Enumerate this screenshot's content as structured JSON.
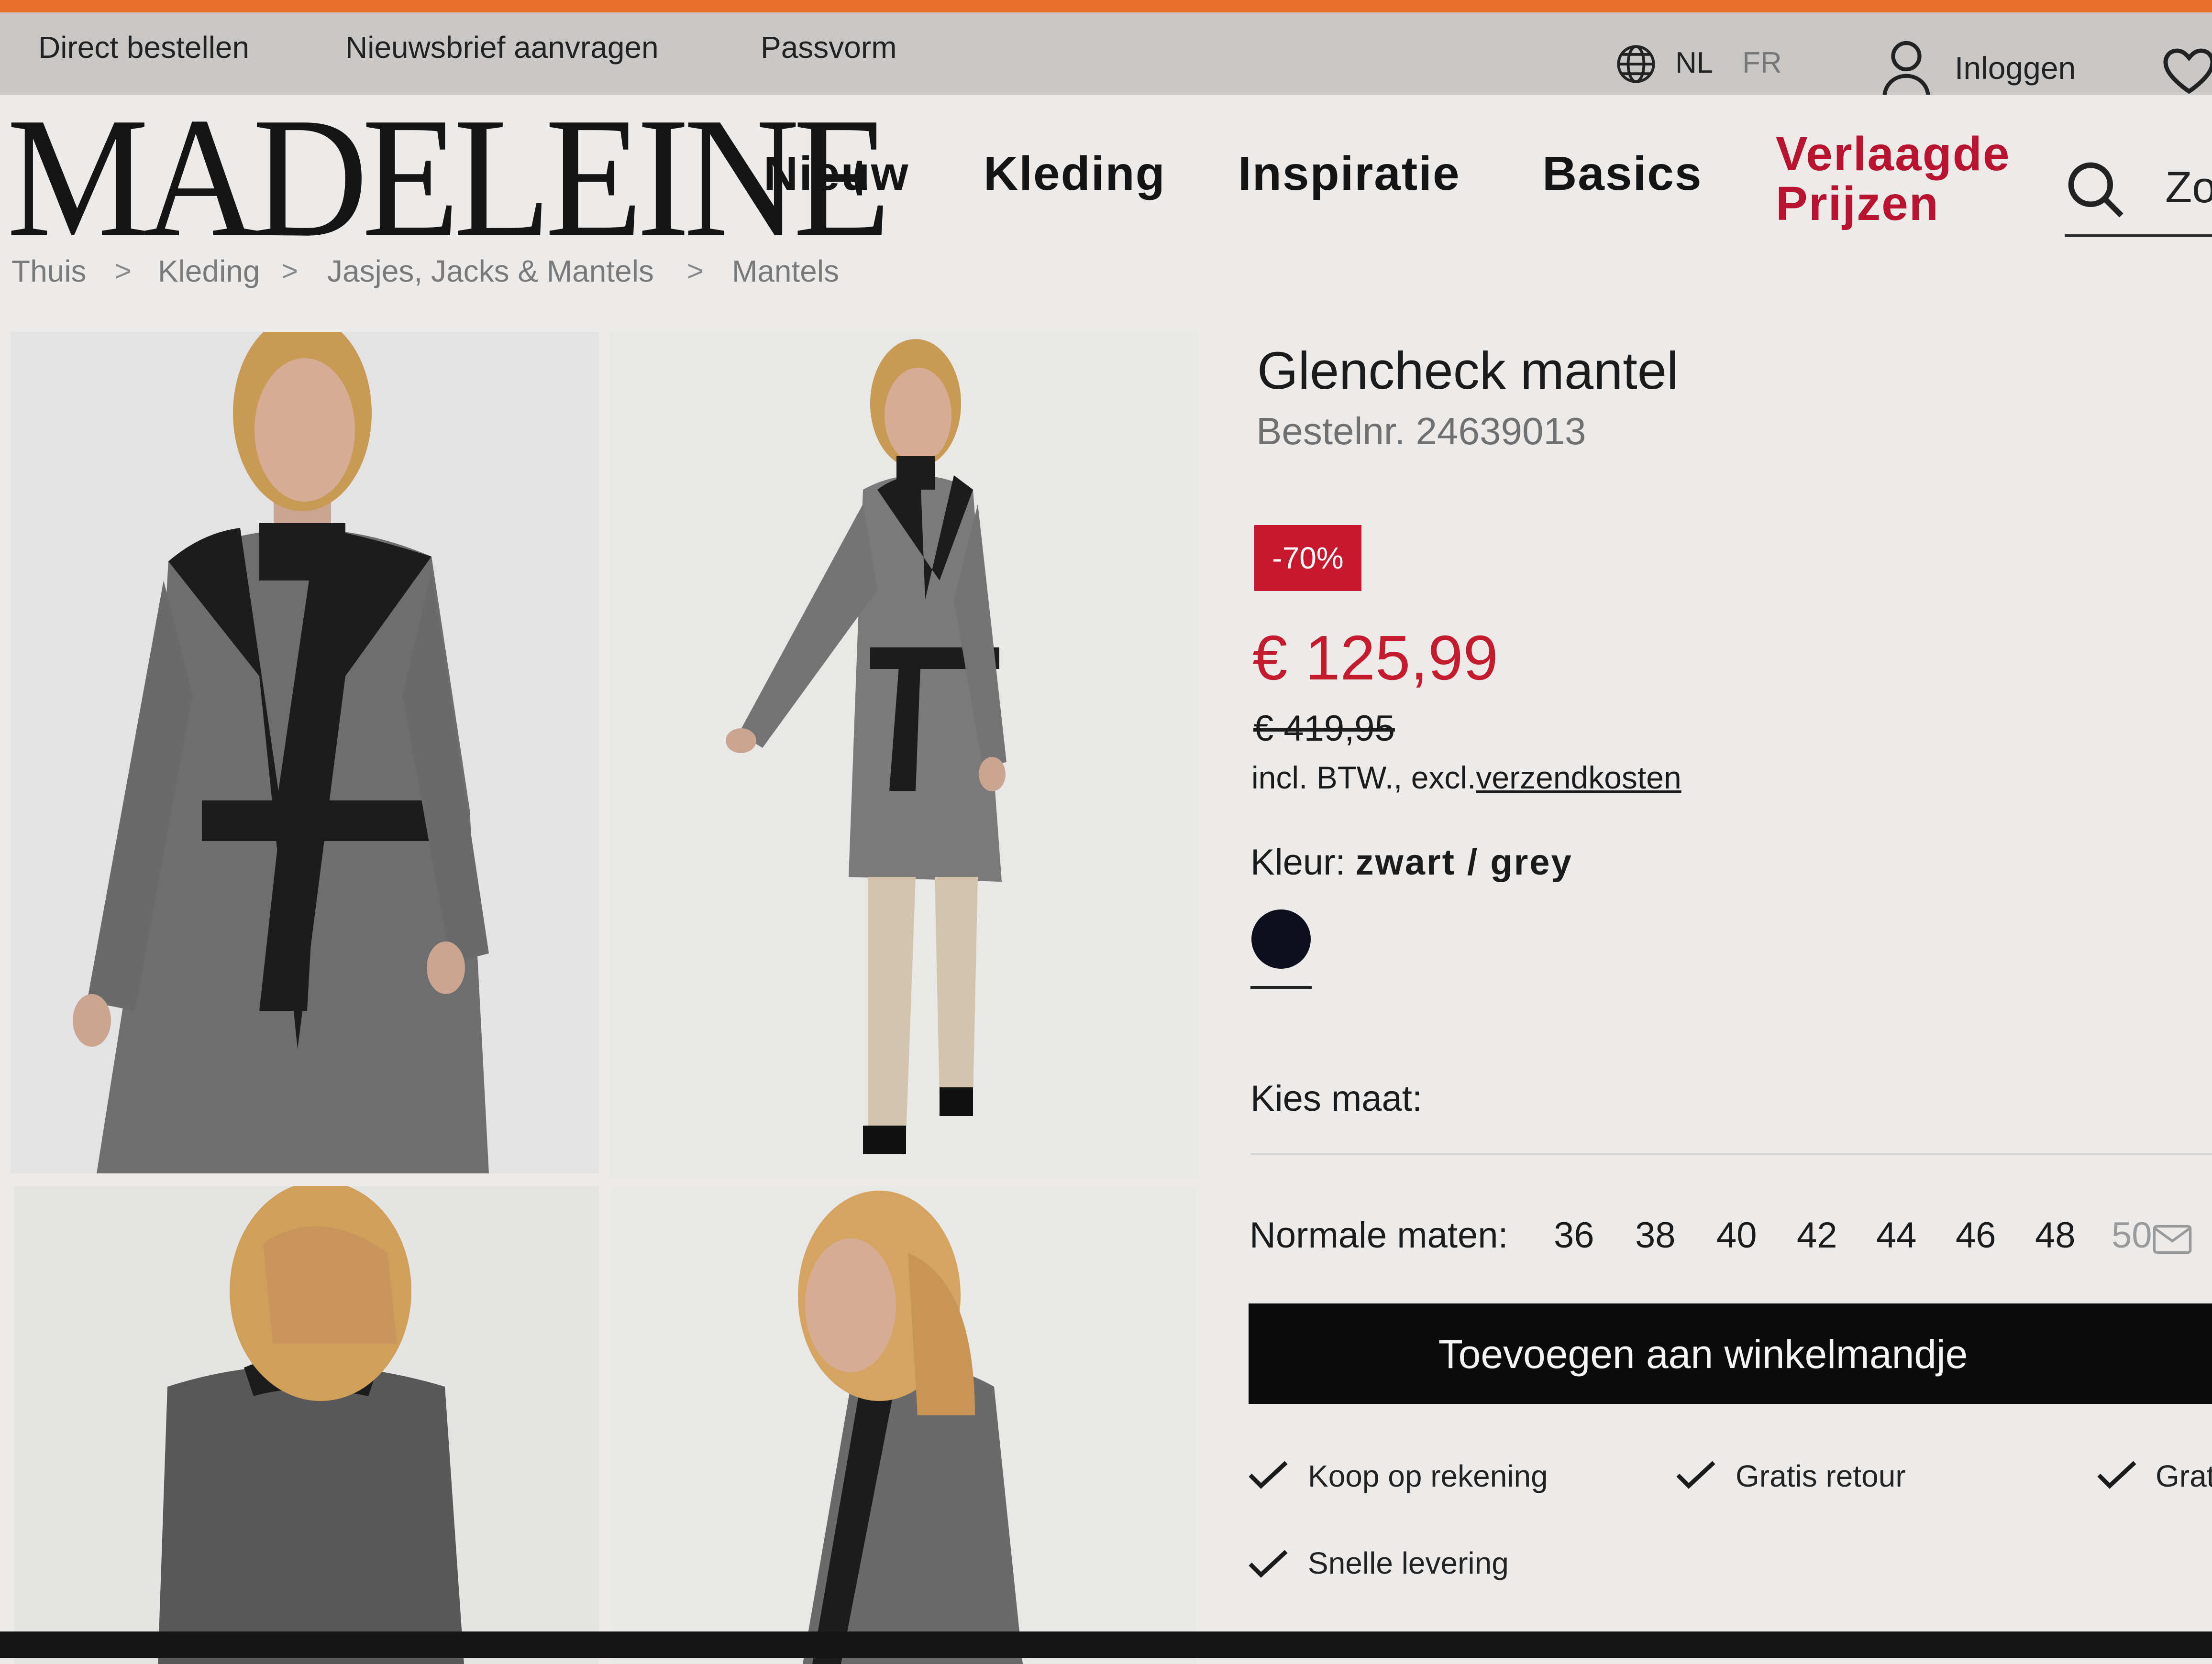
{
  "colors": {
    "accent": "#e8702a",
    "sale": "#b8132f",
    "price": "#c41c2e",
    "button": "#0b0b0b"
  },
  "topbar": {
    "links": [
      "Direct bestellen",
      "Nieuwsbrief aanvragen",
      "Passvorm"
    ],
    "lang_active": "NL",
    "lang_other": "FR",
    "login": "Inloggen",
    "icons": [
      "globe-icon",
      "user-icon",
      "heart-icon"
    ]
  },
  "header": {
    "logo": "MADELEINE",
    "nav": [
      "Nieuw",
      "Kleding",
      "Inspiratie",
      "Basics"
    ],
    "nav_sale_line1": "Verlaagde",
    "nav_sale_line2": "Prijzen",
    "search_text": "Zo"
  },
  "breadcrumb": [
    "Thuis",
    "Kleding",
    "Jasjes, Jacks & Mantels",
    "Mantels"
  ],
  "product": {
    "title": "Glencheck mantel",
    "order_number": "Bestelnr. 24639013",
    "discount_badge": "-70%",
    "price": "€ 125,99",
    "old_price": "€ 419,95",
    "vat_text": "incl. BTW., excl.",
    "shipping_link": "verzendkosten",
    "color_label": "Kleur:",
    "color_value": "zwart / grey",
    "color_swatch": "#0d0f1c",
    "size_prompt": "Kies maat:",
    "sizes_label": "Normale maten:",
    "sizes": [
      "36",
      "38",
      "40",
      "42",
      "44",
      "46",
      "48"
    ],
    "size_unavailable": "50",
    "add_to_cart": "Toevoegen aan winkelmandje",
    "usps": [
      "Koop op rekening",
      "Gratis retour",
      "Grat",
      "Snelle levering"
    ]
  }
}
